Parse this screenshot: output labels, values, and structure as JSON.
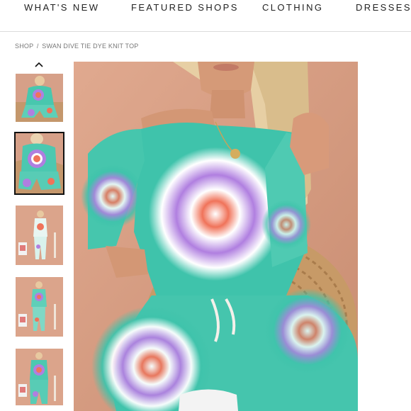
{
  "nav": {
    "items": [
      "WHAT'S NEW",
      "FEATURED SHOPS",
      "CLOTHING",
      "DRESSES"
    ]
  },
  "breadcrumb": {
    "shop": "SHOP",
    "separator": "/",
    "product": "SWAN DIVE TIE DYE KNIT TOP"
  },
  "gallery": {
    "up_icon": "chevron-up-icon",
    "thumbnails": [
      "thumbnail-1",
      "thumbnail-2",
      "thumbnail-3",
      "thumbnail-4",
      "thumbnail-5"
    ],
    "active_thumbnail": 2,
    "colors": {
      "background": "#d9a28a",
      "teal": "#3fc3ab",
      "purple": "#b07fe0",
      "orange": "#f0735a",
      "chair": "#c79a67"
    }
  }
}
